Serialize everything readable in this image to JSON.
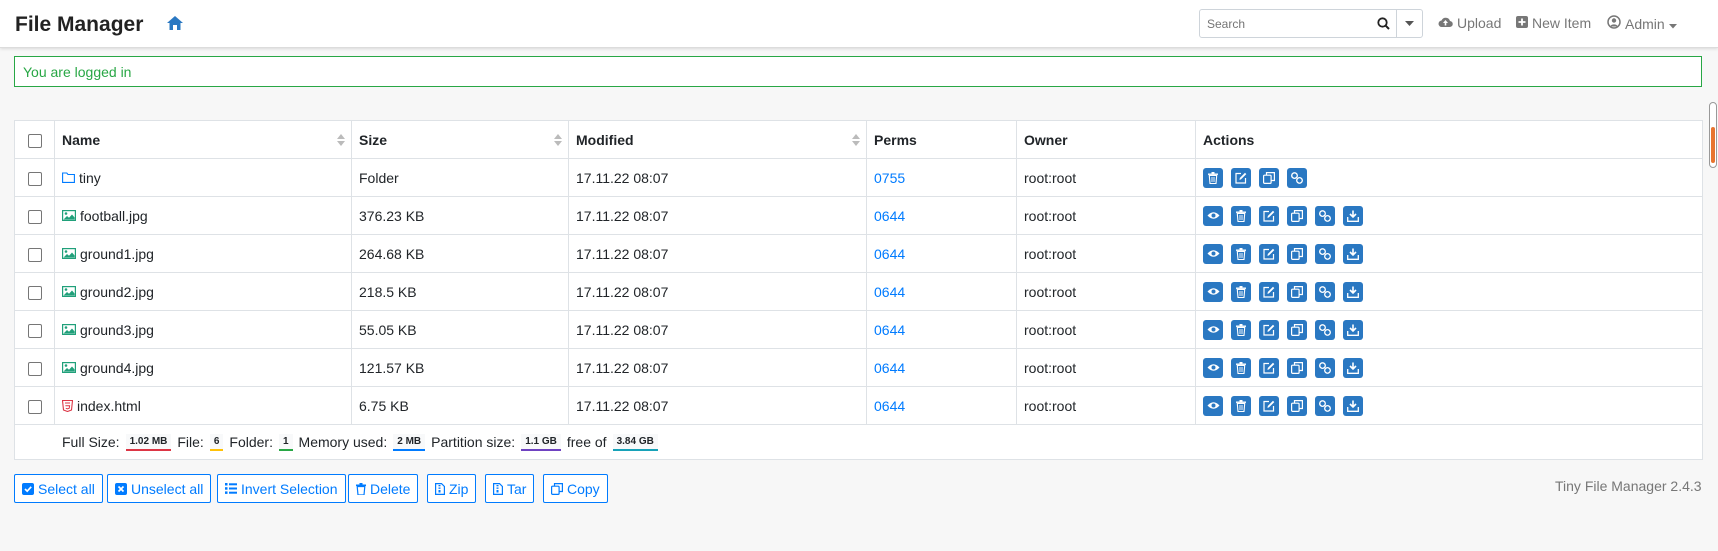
{
  "app": {
    "title": "File Manager"
  },
  "header": {
    "search_placeholder": "Search",
    "upload_label": "Upload",
    "new_item_label": "New Item",
    "user_label": "Admin"
  },
  "alert": {
    "message": "You are logged in"
  },
  "table": {
    "columns": {
      "name": "Name",
      "size": "Size",
      "modified": "Modified",
      "perms": "Perms",
      "owner": "Owner",
      "actions": "Actions"
    },
    "rows": [
      {
        "name": "tiny",
        "type": "folder",
        "size": "Folder",
        "modified": "17.11.22 08:07",
        "perms": "0755",
        "owner": "root:root"
      },
      {
        "name": "football.jpg",
        "type": "image",
        "size": "376.23 KB",
        "modified": "17.11.22 08:07",
        "perms": "0644",
        "owner": "root:root"
      },
      {
        "name": "ground1.jpg",
        "type": "image",
        "size": "264.68 KB",
        "modified": "17.11.22 08:07",
        "perms": "0644",
        "owner": "root:root"
      },
      {
        "name": "ground2.jpg",
        "type": "image",
        "size": "218.5 KB",
        "modified": "17.11.22 08:07",
        "perms": "0644",
        "owner": "root:root"
      },
      {
        "name": "ground3.jpg",
        "type": "image",
        "size": "55.05 KB",
        "modified": "17.11.22 08:07",
        "perms": "0644",
        "owner": "root:root"
      },
      {
        "name": "ground4.jpg",
        "type": "image",
        "size": "121.57 KB",
        "modified": "17.11.22 08:07",
        "perms": "0644",
        "owner": "root:root"
      },
      {
        "name": "index.html",
        "type": "html",
        "size": "6.75 KB",
        "modified": "17.11.22 08:07",
        "perms": "0644",
        "owner": "root:root"
      }
    ]
  },
  "footer": {
    "full_size_label": "Full Size:",
    "full_size": "1.02 MB",
    "file_label": "File:",
    "file_count": "6",
    "folder_label": "Folder:",
    "folder_count": "1",
    "memory_label": "Memory used:",
    "memory": "2 MB",
    "partition_label": "Partition size:",
    "partition": "1.1 GB",
    "free_label": "free of",
    "total": "3.84 GB"
  },
  "buttons": {
    "select_all": "Select all",
    "unselect_all": "Unselect all",
    "invert": "Invert Selection",
    "delete": "Delete",
    "zip": "Zip",
    "tar": "Tar",
    "copy": "Copy"
  },
  "version": "Tiny File Manager 2.4.3",
  "colors": {
    "accent": "#007bff",
    "action_button": "#2a78c2",
    "success": "#28a745",
    "badge_full_size": "#dc3545",
    "badge_file": "#ffc107",
    "badge_folder": "#28a745",
    "badge_memory": "#007bff",
    "badge_partition": "#6f42c1",
    "badge_total": "#17a2b8"
  }
}
